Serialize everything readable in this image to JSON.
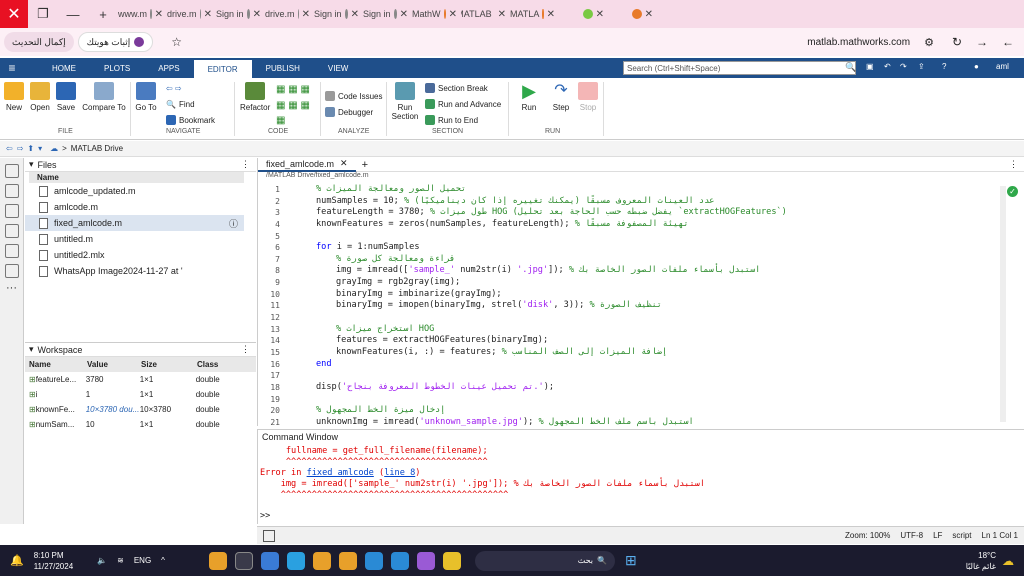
{
  "browser": {
    "tabs": [
      {
        "label": "www.m",
        "fav": "#888888"
      },
      {
        "label": "drive.m",
        "fav": "#888888"
      },
      {
        "label": "Sign in",
        "fav": "#888888"
      },
      {
        "label": "drive.m",
        "fav": "#888888"
      },
      {
        "label": "Sign in",
        "fav": "#888888"
      },
      {
        "label": "Sign in",
        "fav": "#888888"
      },
      {
        "label": "MathW",
        "fav": "#e87a2a"
      },
      {
        "label": "MATLAB",
        "fav": "#e87a2a"
      },
      {
        "label": "MATLA",
        "fav": "#e87a2a"
      },
      {
        "label": "",
        "fav": "#7ac943"
      },
      {
        "label": "",
        "fav": "#e87a2a"
      }
    ],
    "update_label": "إكمال التحديث",
    "identity_label": "إثبات هويتك",
    "url": "matlab.mathworks.com",
    "close_icon": "✕",
    "minimize_icon": "—",
    "restore_icon": "❐",
    "new_tab_icon": "+"
  },
  "menu": {
    "tabs": [
      "HOME",
      "PLOTS",
      "APPS",
      "EDITOR",
      "PUBLISH",
      "VIEW"
    ],
    "search_placeholder": "Search (Ctrl+Shift+Space)",
    "user": "aml"
  },
  "ribbon": {
    "new": "New",
    "open": "Open",
    "save": "Save",
    "compare": "Compare To",
    "goto": "Go To",
    "find": "Find",
    "bookmark": "Bookmark",
    "refactor": "Refactor",
    "code_issues": "Code Issues",
    "debugger": "Debugger",
    "run_section": "Run Section",
    "section_break": "Section Break",
    "run_advance": "Run and Advance",
    "run_end": "Run to End",
    "run": "Run",
    "step": "Step",
    "stop": "Stop",
    "groups": {
      "file": "FILE",
      "navigate": "NAVIGATE",
      "code": "CODE",
      "analyze": "ANALYZE",
      "section": "SECTION",
      "run": "RUN"
    }
  },
  "path": {
    "folder": "MATLAB Drive",
    "sep": ">"
  },
  "files": {
    "title": "Files",
    "col": "Name",
    "items": [
      "amlcode_updated.m",
      "amlcode.m",
      "fixed_amlcode.m",
      "untitled.m",
      "untitled2.mlx",
      "WhatsApp Image2024-11-27  at '"
    ]
  },
  "workspace": {
    "title": "Workspace",
    "headers": [
      "Name",
      "Value",
      "Size",
      "Class"
    ],
    "rows": [
      [
        "featureLe...",
        "3780",
        "1×1",
        "double"
      ],
      [
        "i",
        "1",
        "1×1",
        "double"
      ],
      [
        "knownFe...",
        "10×3780 dou...",
        "10×3780",
        "double"
      ],
      [
        "numSam...",
        "10",
        "1×1",
        "double"
      ]
    ]
  },
  "editor": {
    "tab": "fixed_amlcode.m",
    "path": "/MATLAB Drive/fixed_amlcode.m",
    "lines": [
      {
        "n": "1",
        "i": 0,
        "p": [
          {
            "c": "cm",
            "t": "% تحميل الصور ومعالجة الميزات"
          }
        ]
      },
      {
        "n": "2",
        "i": 0,
        "p": [
          {
            "c": "",
            "t": "numSamples = 10; "
          },
          {
            "c": "cm",
            "t": "% عدد العينات المعروف مسبقًا (يمكنك تغييره إذا كان ديناميكيًا)"
          }
        ]
      },
      {
        "n": "3",
        "i": 0,
        "p": [
          {
            "c": "",
            "t": "featureLength = 3780; "
          },
          {
            "c": "cm",
            "t": "% طول ميزات HOG (يفضل ضبطه حسب الحاجة بعد تحليل `extractHOGFeatures`)"
          }
        ]
      },
      {
        "n": "4",
        "i": 0,
        "p": [
          {
            "c": "",
            "t": "knownFeatures = zeros(numSamples, featureLength); "
          },
          {
            "c": "cm",
            "t": "% تهيئة المصفوفة مسبقًا"
          }
        ]
      },
      {
        "n": "5",
        "i": 0,
        "p": []
      },
      {
        "n": "6",
        "i": 0,
        "p": [
          {
            "c": "kw",
            "t": "for"
          },
          {
            "c": "",
            "t": " i = 1:numSamples"
          }
        ]
      },
      {
        "n": "7",
        "i": 1,
        "p": [
          {
            "c": "cm",
            "t": "% قراءة ومعالجة كل صورة"
          }
        ]
      },
      {
        "n": "8",
        "i": 1,
        "p": [
          {
            "c": "",
            "t": "img = imread(["
          },
          {
            "c": "st",
            "t": "'sample_'"
          },
          {
            "c": "",
            "t": " num2str(i) "
          },
          {
            "c": "st",
            "t": "'.jpg'"
          },
          {
            "c": "",
            "t": "]); "
          },
          {
            "c": "cm",
            "t": "% استبدل بأسماء ملفات الصور الخاصة بك"
          }
        ]
      },
      {
        "n": "9",
        "i": 1,
        "p": [
          {
            "c": "",
            "t": "grayImg = rgb2gray(img);"
          }
        ]
      },
      {
        "n": "10",
        "i": 1,
        "p": [
          {
            "c": "",
            "t": "binaryImg = imbinarize(grayImg);"
          }
        ]
      },
      {
        "n": "11",
        "i": 1,
        "p": [
          {
            "c": "",
            "t": "binaryImg = imopen(binaryImg, strel("
          },
          {
            "c": "st",
            "t": "'disk'"
          },
          {
            "c": "",
            "t": ", 3)); "
          },
          {
            "c": "cm",
            "t": "% تنظيف الصورة"
          }
        ]
      },
      {
        "n": "12",
        "i": 0,
        "p": []
      },
      {
        "n": "13",
        "i": 1,
        "p": [
          {
            "c": "cm",
            "t": "% استخراج ميزات HOG"
          }
        ]
      },
      {
        "n": "14",
        "i": 1,
        "p": [
          {
            "c": "",
            "t": "features = extractHOGFeatures(binaryImg);"
          }
        ]
      },
      {
        "n": "15",
        "i": 1,
        "p": [
          {
            "c": "",
            "t": "knownFeatures(i, :) = features; "
          },
          {
            "c": "cm",
            "t": "% إضافة الميزات إلى الصف المناسب"
          }
        ]
      },
      {
        "n": "16",
        "i": 0,
        "p": [
          {
            "c": "kw",
            "t": "end"
          }
        ]
      },
      {
        "n": "17",
        "i": 0,
        "p": []
      },
      {
        "n": "18",
        "i": 0,
        "p": [
          {
            "c": "",
            "t": "disp("
          },
          {
            "c": "st",
            "t": "'تم تحميل عينات الخطوط المعروفة بنجاح.'"
          },
          {
            "c": "",
            "t": ");"
          }
        ]
      },
      {
        "n": "19",
        "i": 0,
        "p": []
      },
      {
        "n": "20",
        "i": 0,
        "p": [
          {
            "c": "cm",
            "t": "% إدخال ميزة الخط المجهول"
          }
        ]
      },
      {
        "n": "21",
        "i": 0,
        "p": [
          {
            "c": "",
            "t": "unknownImg = imread("
          },
          {
            "c": "st",
            "t": "'unknown_sample.jpg'"
          },
          {
            "c": "",
            "t": "); "
          },
          {
            "c": "cm",
            "t": "% استبدل باسم ملف الخط المجهول"
          }
        ]
      }
    ]
  },
  "cmd": {
    "title": "Command Window",
    "l1": "     fullname = get_full_filename(filename);",
    "l2": "     ^^^^^^^^^^^^^^^^^^^^^^^^^^^^^^^^^^^^^^^",
    "l3a": "Error in ",
    "l3b": "fixed_amlcode",
    "l3c": " (",
    "l3d": "line 8",
    "l3e": ")",
    "l4": "    img = imread(['sample_' num2str(i) '.jpg']); % استبدل بأسماء ملفات الصور الخاصة بك",
    "l5": "    ^^^^^^^^^^^^^^^^^^^^^^^^^^^^^^^^^^^^^^^^^^^^",
    "prompt": ">>"
  },
  "status": {
    "zoom": "Zoom: 100%",
    "enc": "UTF-8",
    "eol": "LF",
    "type": "script",
    "pos": "Ln 1 Col 1"
  },
  "taskbar": {
    "time": "8:10 PM",
    "date": "11/27/2024",
    "lang": "ENG",
    "search": "بحث",
    "temp": "18°C",
    "weather": "غائم غالبًا"
  }
}
